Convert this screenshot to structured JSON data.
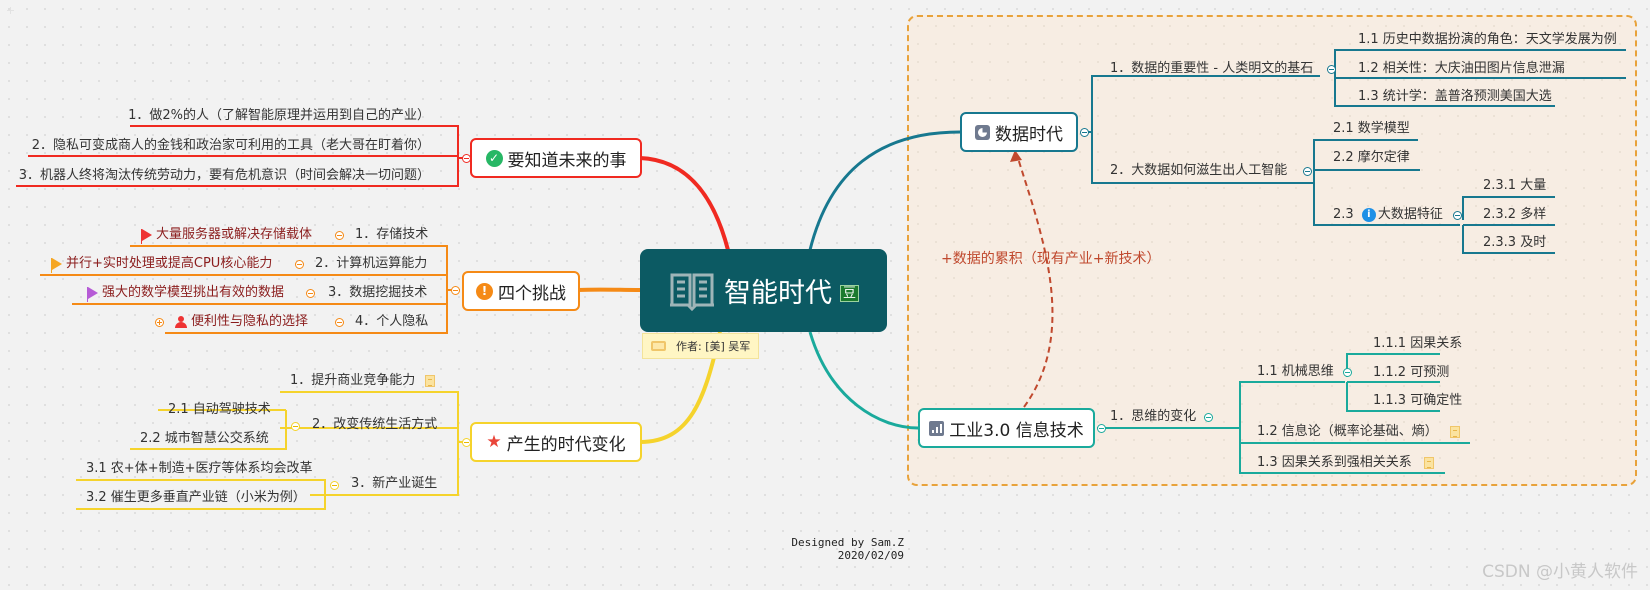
{
  "center": {
    "title": "智能时代",
    "badge": "豆",
    "icon": "book-icon",
    "author_label": "作者: [美] 吴军"
  },
  "colors": {
    "red": "#f02a21",
    "orange": "#f58a16",
    "yellow": "#f5d32c",
    "blue": "#17788f",
    "teal": "#1aaa9c",
    "center_bg": "#0c5a63",
    "relation": "#c0492e"
  },
  "left": {
    "future": {
      "title": "要知道未来的事",
      "icon": "check-circle-icon",
      "items": [
        "1．做2%的人（了解智能原理并运用到自己的产业）",
        "2．隐私可变成商人的金钱和政治家可利用的工具（老大哥在盯着你）",
        "3．机器人终将淘汰传统劳动力，要有危机意识（时间会解决一切问题）"
      ]
    },
    "challenges": {
      "title": "四个挑战",
      "icon": "exclamation-circle-icon",
      "items": [
        {
          "label": "1．存储技术",
          "child": "大量服务器或解决存储载体",
          "marker": "red-flag-icon"
        },
        {
          "label": "2．计算机运算能力",
          "child": "并行+实时处理或提高CPU核心能力",
          "marker": "orange-flag-icon"
        },
        {
          "label": "3．数据挖掘技术",
          "child": "强大的数学模型挑出有效的数据",
          "marker": "purple-flag-icon"
        },
        {
          "label": "4．个人隐私",
          "child": "便利性与隐私的选择",
          "marker": "person-icon"
        }
      ]
    },
    "changes": {
      "title": "产生的时代变化",
      "icon": "star-icon",
      "items": [
        {
          "label": "1．提升商业竞争能力",
          "children": []
        },
        {
          "label": "2．改变传统生活方式",
          "children": [
            "2.1  自动驾驶技术",
            "2.2  城市智慧公交系统"
          ]
        },
        {
          "label": "3．新产业诞生",
          "children": [
            "3.1  农+体+制造+医疗等体系均会改革",
            "3.2  催生更多垂直产业链（小米为例）"
          ]
        }
      ]
    }
  },
  "right": {
    "data_era": {
      "title": "数据时代",
      "icon": "pie-chart-icon",
      "branches": [
        {
          "label": "1．数据的重要性 - 人类明文的基石",
          "children": [
            "1.1  历史中数据扮演的角色：天文学发展为例",
            "1.2  相关性：大庆油田图片信息泄漏",
            "1.3  统计学：盖普洛预测美国大选"
          ]
        },
        {
          "label": "2．大数据如何滋生出人工智能",
          "children": [
            "2.1  数学模型",
            "2.2  摩尔定律",
            "2.3"
          ],
          "feature": {
            "label": "大数据特征",
            "children": [
              "2.3.1  大量",
              "2.3.2  多样",
              "2.3.3  及时"
            ]
          }
        }
      ]
    },
    "industry": {
      "title": "工业3.0 信息技术",
      "icon": "bar-chart-icon",
      "branches": [
        {
          "label": "1．思维的变化",
          "children": [
            {
              "label": "1.1  机械思维",
              "children": [
                "1.1.1  因果关系",
                "1.1.2  可预测",
                "1.1.3  可确定性"
              ]
            },
            {
              "label": "1.2  信息论（概率论基础、熵）",
              "children": []
            },
            {
              "label": "1.3  因果关系到强相关关系",
              "children": []
            }
          ]
        }
      ]
    },
    "relation_label": "+数据的累积（现有产业+新技术）"
  },
  "footer": {
    "designed_by": "Designed by Sam.Z",
    "date": "2020/02/09"
  },
  "watermark": "CSDN @小黄人软件"
}
